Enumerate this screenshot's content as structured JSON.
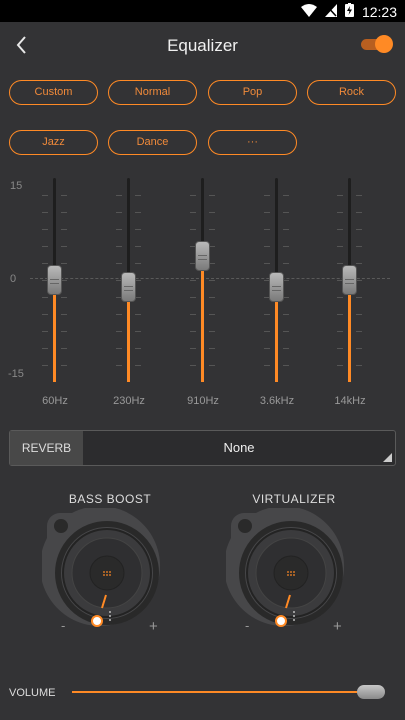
{
  "status_bar": {
    "time": "12:23"
  },
  "header": {
    "title": "Equalizer",
    "enabled": true
  },
  "presets": [
    {
      "label": "Custom",
      "active": true
    },
    {
      "label": "Normal",
      "active": false
    },
    {
      "label": "Pop",
      "active": false
    },
    {
      "label": "Rock",
      "active": false
    },
    {
      "label": "Jazz",
      "active": false
    },
    {
      "label": "Dance",
      "active": false
    },
    {
      "label": "···",
      "active": false
    }
  ],
  "eq": {
    "scale": {
      "max": "15",
      "zero": "0",
      "min": "-15"
    },
    "bands": [
      {
        "freq": "60Hz",
        "gain_db": 0
      },
      {
        "freq": "230Hz",
        "gain_db": -1
      },
      {
        "freq": "910Hz",
        "gain_db": 3.5
      },
      {
        "freq": "3.6kHz",
        "gain_db": -1
      },
      {
        "freq": "14kHz",
        "gain_db": 0
      }
    ]
  },
  "reverb": {
    "label": "REVERB",
    "value": "None"
  },
  "bass_boost": {
    "label": "BASS BOOST",
    "minus": "-",
    "plus": "+",
    "level": 0.05
  },
  "virtualizer": {
    "label": "VIRTUALIZER",
    "minus": "-",
    "plus": "+",
    "level": 0.05
  },
  "volume": {
    "label": "VOLUME",
    "level": 0.97
  },
  "colors": {
    "accent": "#ff8a25",
    "background": "#333335"
  }
}
